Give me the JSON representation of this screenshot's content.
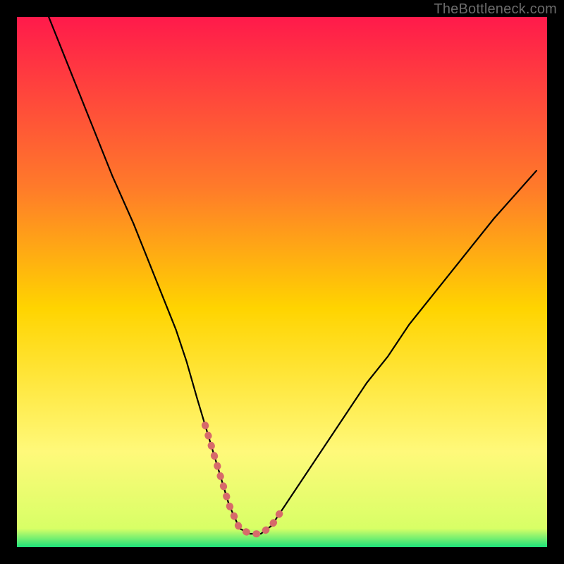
{
  "watermark": "TheBottleneck.com",
  "colors": {
    "gradient_top": "#ff1a4b",
    "gradient_mid_upper": "#ff7a2a",
    "gradient_mid": "#ffd400",
    "gradient_mid_lower": "#fff97a",
    "gradient_bottom": "#1de27a",
    "curve": "#000000",
    "highlight": "#d76a6a",
    "frame_bg": "#000000"
  },
  "chart_data": {
    "type": "line",
    "title": "",
    "xlabel": "",
    "ylabel": "",
    "xlim": [
      0,
      100
    ],
    "ylim": [
      0,
      100
    ],
    "grid": false,
    "legend": false,
    "annotations": [],
    "series": [
      {
        "name": "curve",
        "x": [
          6,
          10,
          14,
          18,
          22,
          26,
          28,
          30,
          32,
          34,
          35.5,
          37,
          38.5,
          40,
          42,
          44,
          46,
          48,
          50,
          54,
          58,
          62,
          66,
          70,
          74,
          78,
          82,
          86,
          90,
          94,
          98
        ],
        "y": [
          100,
          90,
          80,
          70,
          61,
          51,
          46,
          41,
          35,
          28,
          23,
          18,
          13,
          8,
          3.5,
          2.5,
          2.5,
          4,
          7,
          13,
          19,
          25,
          31,
          36,
          42,
          47,
          52,
          57,
          62,
          66.5,
          71
        ]
      },
      {
        "name": "bottom-highlight",
        "x": [
          35.5,
          37,
          38.5,
          40,
          42,
          44,
          46,
          48,
          50
        ],
        "y": [
          23,
          18,
          13,
          8,
          3.5,
          2.5,
          2.5,
          4,
          7
        ]
      }
    ]
  }
}
